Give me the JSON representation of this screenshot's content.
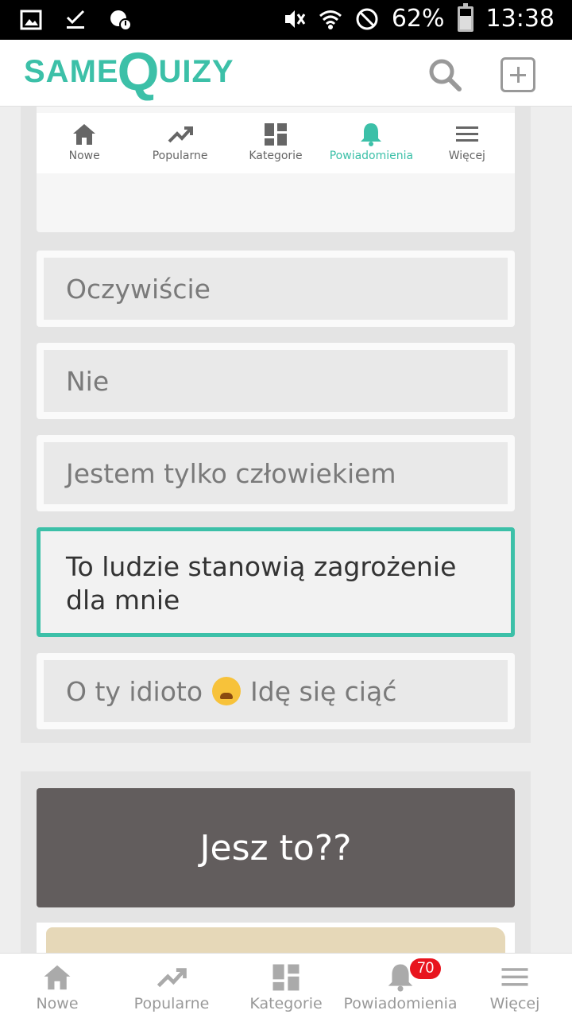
{
  "status_bar": {
    "battery": "62%",
    "time": "13:38"
  },
  "header": {
    "logo_part1": "SAME",
    "logo_part2": "Q",
    "logo_part3": "UIZY",
    "accent": "#3cc0a8"
  },
  "embedded_nav": {
    "items": [
      {
        "label": "Nowe",
        "icon": "home-icon"
      },
      {
        "label": "Popularne",
        "icon": "trending-icon"
      },
      {
        "label": "Kategorie",
        "icon": "grid-icon"
      },
      {
        "label": "Powiadomienia",
        "icon": "bell-icon",
        "active": true
      },
      {
        "label": "Więcej",
        "icon": "menu-icon"
      }
    ]
  },
  "answers": [
    {
      "text": "Oczywiście",
      "selected": false
    },
    {
      "text": "Nie",
      "selected": false
    },
    {
      "text": "Jestem tylko człowiekiem",
      "selected": false
    },
    {
      "text": "To ludzie stanowią zagrożenie dla mnie",
      "selected": true
    },
    {
      "text_before": "O ty idioto",
      "text_after": "Idę się ciąć",
      "emoji": "crying-face-emoji",
      "selected": false
    }
  ],
  "next_quiz": {
    "title": "Jesz to??"
  },
  "bottom_nav": {
    "items": [
      {
        "label": "Nowe",
        "icon": "home-icon"
      },
      {
        "label": "Popularne",
        "icon": "trending-icon"
      },
      {
        "label": "Kategorie",
        "icon": "grid-icon"
      },
      {
        "label": "Powiadomienia",
        "icon": "bell-icon",
        "badge": "70"
      },
      {
        "label": "Więcej",
        "icon": "menu-icon"
      }
    ]
  }
}
